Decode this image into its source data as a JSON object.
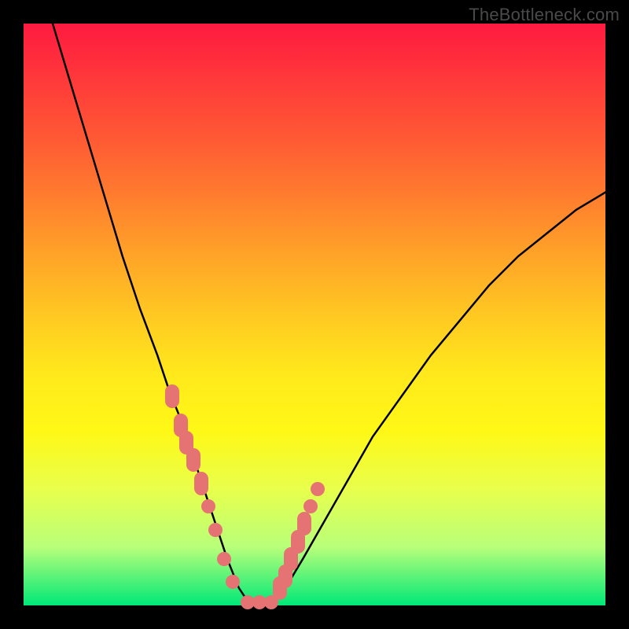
{
  "watermark": "TheBottleneck.com",
  "chart_data": {
    "type": "line",
    "title": "",
    "xlabel": "",
    "ylabel": "",
    "xlim": [
      0,
      100
    ],
    "ylim": [
      0,
      100
    ],
    "grid": false,
    "legend": false,
    "background_gradient": [
      "#ff1a40",
      "#ff7e2e",
      "#ffe81c",
      "#00e878"
    ],
    "series": [
      {
        "name": "bottleneck-curve",
        "type": "line",
        "color": "#000000",
        "x": [
          5,
          8,
          11,
          14,
          17,
          20,
          23,
          25,
          27,
          29,
          31,
          33,
          35,
          37,
          39,
          42,
          45,
          48,
          52,
          56,
          60,
          65,
          70,
          75,
          80,
          85,
          90,
          95,
          100
        ],
        "y": [
          100,
          90,
          80,
          70,
          60,
          51,
          43,
          37,
          32,
          26,
          20,
          14,
          8,
          3,
          0,
          0,
          3,
          8,
          15,
          22,
          29,
          36,
          43,
          49,
          55,
          60,
          64,
          68,
          71
        ]
      },
      {
        "name": "highlighted-points",
        "type": "scatter",
        "color": "#e57373",
        "x": [
          25.5,
          27.0,
          28.0,
          29.2,
          30.5,
          31.8,
          33.0,
          34.5,
          36.0,
          38.5,
          40.5,
          42.5,
          44.0,
          45.0,
          46.0,
          47.2,
          48.2,
          49.3,
          50.5
        ],
        "y": [
          36.0,
          31.0,
          28.0,
          25.0,
          21.0,
          17.0,
          13.0,
          8.0,
          4.0,
          0.5,
          0.5,
          0.5,
          3.0,
          5.0,
          8.0,
          11.0,
          14.0,
          17.0,
          20.0
        ]
      }
    ],
    "annotation": "V-shaped bottleneck curve over a vertical red→yellow→green gradient. Salmon dots mark the lower portion of the V near the minimum."
  }
}
